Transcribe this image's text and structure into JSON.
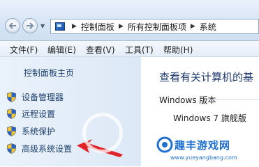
{
  "address_bar": {
    "breadcrumbs": [
      "控制面板",
      "所有控制面板项",
      "系统"
    ],
    "icon": "control-panel-icon"
  },
  "menu": {
    "items": [
      "文件(F)",
      "编辑(E)",
      "查看(V)",
      "工具(T)",
      "帮助(H)"
    ]
  },
  "left_pane": {
    "home_link": "控制面板主页",
    "tasks": [
      {
        "label": "设备管理器",
        "icon": "uac-shield-icon"
      },
      {
        "label": "远程设置",
        "icon": "uac-shield-icon"
      },
      {
        "label": "系统保护",
        "icon": "uac-shield-icon"
      },
      {
        "label": "高级系统设置",
        "icon": "uac-shield-icon"
      }
    ]
  },
  "main": {
    "title": "查看有关计算机的基",
    "version_heading": "Windows 版本",
    "version_name": "Windows 7 旗舰版"
  },
  "watermark": {
    "site_name": "趣丰游戏网",
    "url": "www.yueyangbang.com"
  },
  "colors": {
    "annotation_arrow": "#e0242a",
    "link": "#1e3f6e",
    "watermark": "#1f6fd0"
  }
}
